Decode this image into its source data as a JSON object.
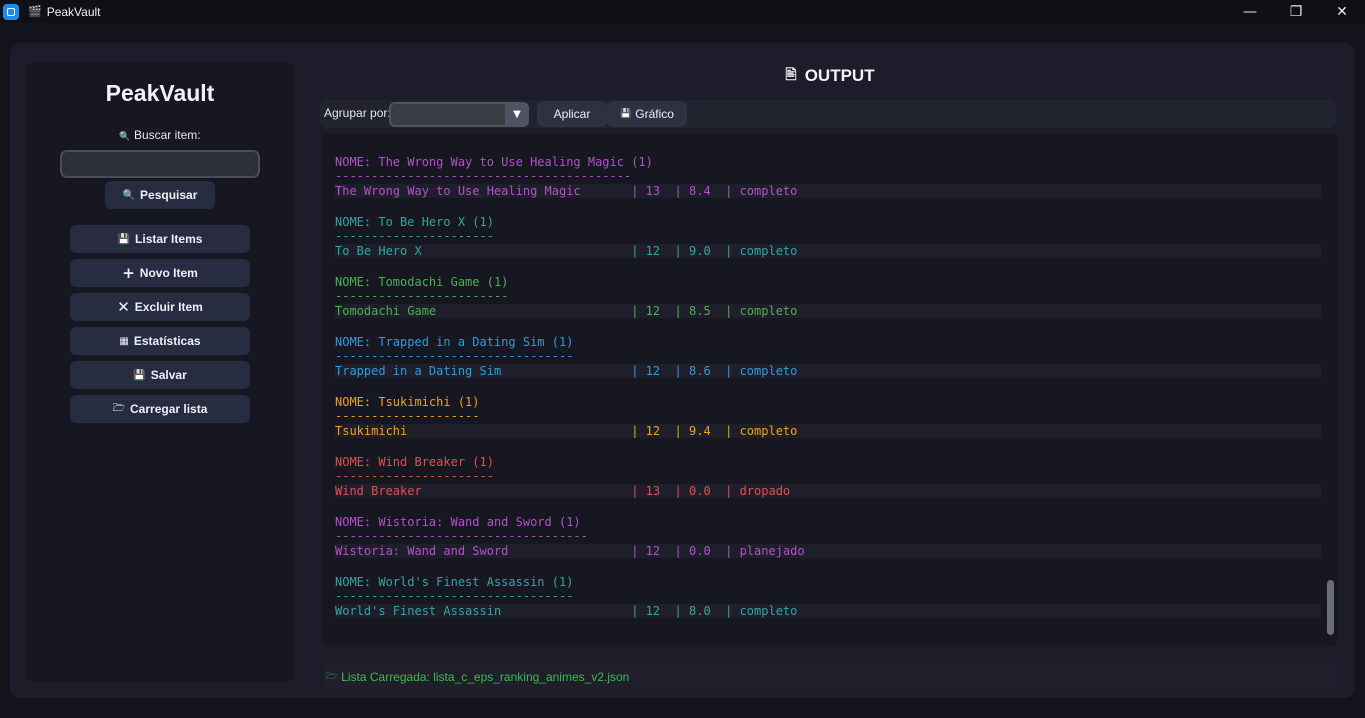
{
  "window": {
    "title": "PeakVault",
    "title_icon": "clapper-icon",
    "controls": [
      "minimize",
      "maximize",
      "close"
    ]
  },
  "sidebar": {
    "brand": "PeakVault",
    "search_label": "Buscar item:",
    "search_value": "",
    "search_button": "Pesquisar",
    "nav": [
      {
        "label": "Listar Items",
        "icon": "floppy-icon"
      },
      {
        "label": "Novo Item",
        "icon": "plus-icon"
      },
      {
        "label": "Excluir Item",
        "icon": "x-icon"
      },
      {
        "label": "Estatísticas",
        "icon": "grid-icon"
      },
      {
        "label": "Salvar",
        "icon": "save-icon"
      },
      {
        "label": "Carregar lista",
        "icon": "folder-icon"
      }
    ]
  },
  "output": {
    "title": "OUTPUT",
    "group_by_label": "Agrupar por:",
    "group_by_value": "",
    "apply_button": "Aplicar",
    "chart_button": "Gráfico",
    "entries": [
      {
        "header": "NOME: The Wrong Way to Use Healing Magic (1)",
        "separator": "-----------------------------------------",
        "name": "The Wrong Way to Use Healing Magic",
        "eps": "13",
        "score": "8.4",
        "status": "completo",
        "color": "#b350c9"
      },
      {
        "header": "NOME: To Be Hero X (1)",
        "separator": "----------------------",
        "name": "To Be Hero X",
        "eps": "12",
        "score": "9.0",
        "status": "completo",
        "color": "#2fa7a0"
      },
      {
        "header": "NOME: Tomodachi Game (1)",
        "separator": "------------------------",
        "name": "Tomodachi Game",
        "eps": "12",
        "score": "8.5",
        "status": "completo",
        "color": "#4caf50"
      },
      {
        "header": "NOME: Trapped in a Dating Sim (1)",
        "separator": "---------------------------------",
        "name": "Trapped in a Dating Sim",
        "eps": "12",
        "score": "8.6",
        "status": "completo",
        "color": "#2d9cdb"
      },
      {
        "header": "NOME: Tsukimichi (1)",
        "separator": "--------------------",
        "name": "Tsukimichi",
        "eps": "12",
        "score": "9.4",
        "status": "completo",
        "color": "#f0a020"
      },
      {
        "header": "NOME: Wind Breaker (1)",
        "separator": "----------------------",
        "name": "Wind Breaker",
        "eps": "13",
        "score": "0.0",
        "status": "dropado",
        "color": "#e05050"
      },
      {
        "header": "NOME: Wistoria: Wand and Sword (1)",
        "separator": "-----------------------------------",
        "name": "Wistoria: Wand and Sword",
        "eps": "12",
        "score": "0.0",
        "status": "planejado",
        "color": "#b350c9"
      },
      {
        "header": "NOME: World's Finest Assassin (1)",
        "separator": "---------------------------------",
        "name": "World's Finest Assassin",
        "eps": "12",
        "score": "8.0",
        "status": "completo",
        "color": "#2fa7a0"
      }
    ]
  },
  "status": {
    "icon": "folder-icon",
    "text": "Lista Carregada: lista_c_eps_ranking_animes_v2.json"
  }
}
